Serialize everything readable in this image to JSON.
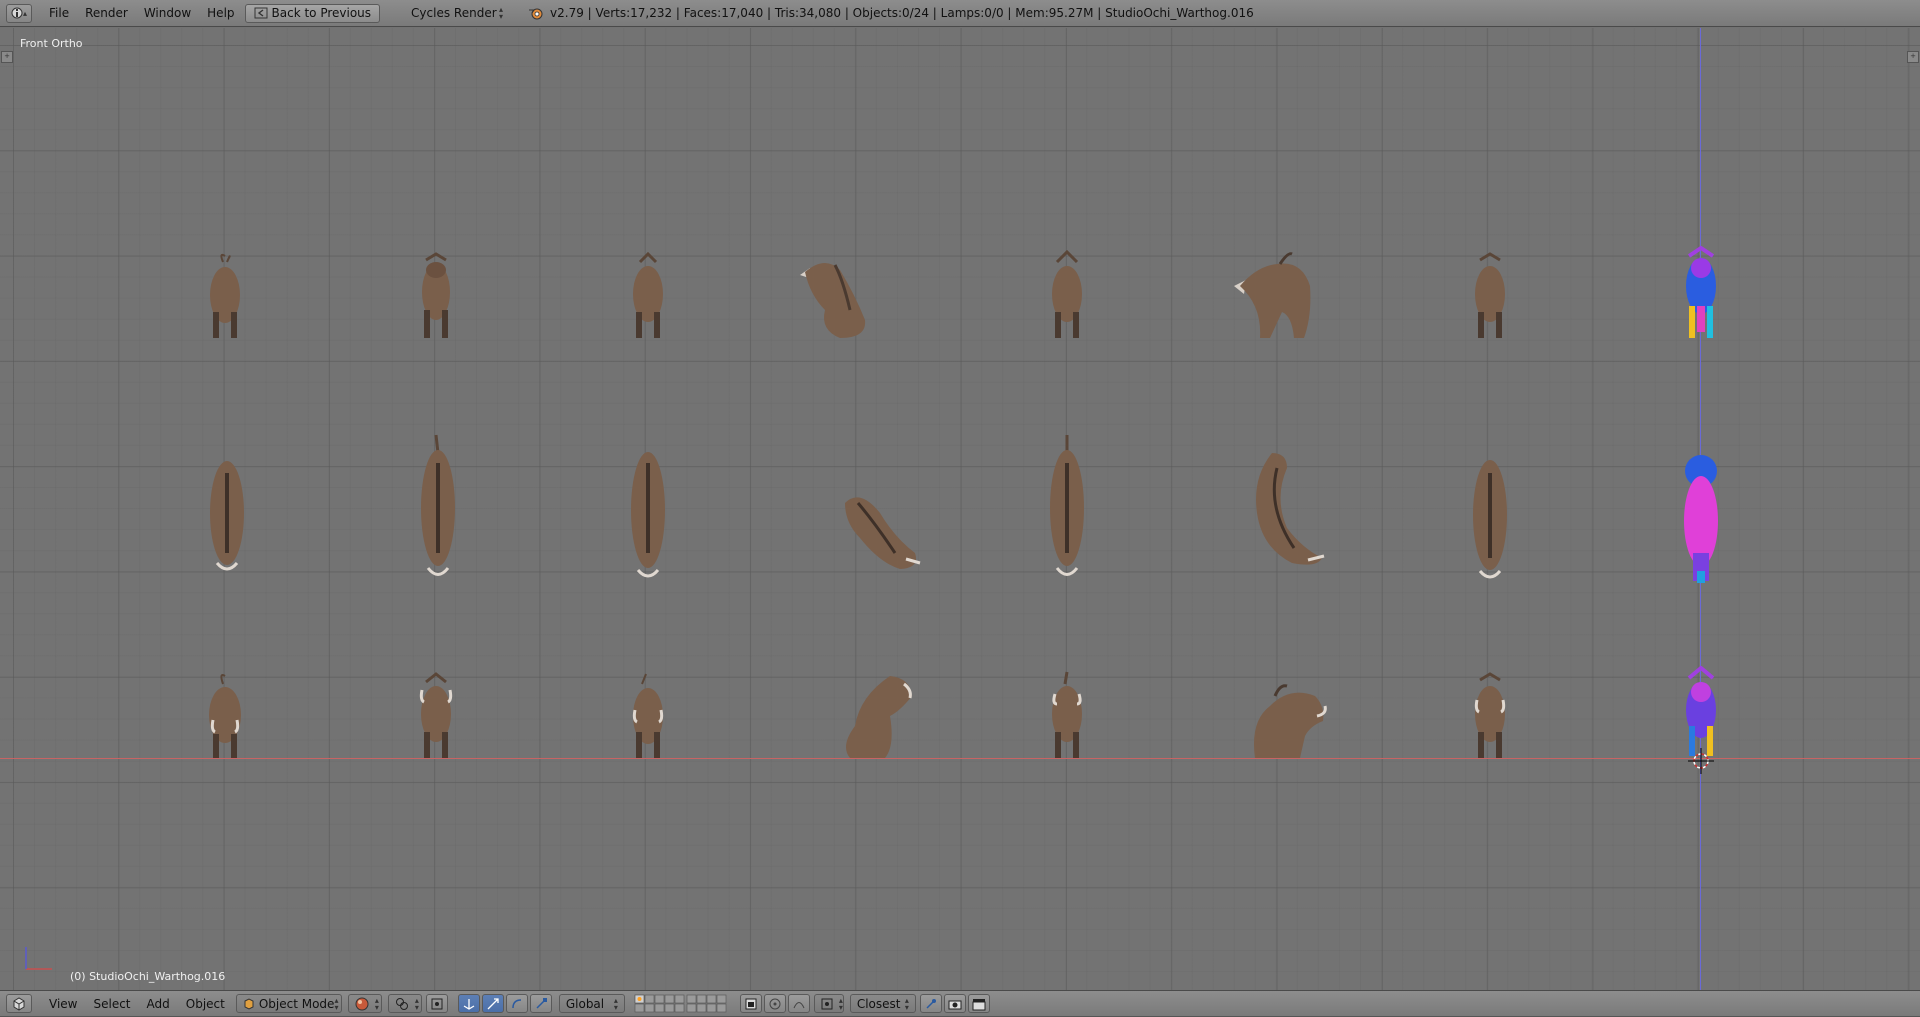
{
  "top_header": {
    "info_icon": "info-icon",
    "menus": [
      "File",
      "Render",
      "Window",
      "Help"
    ],
    "back_button": "Back to Previous",
    "render_engine": "Cycles Render",
    "stats": "v2.79 | Verts:17,232 | Faces:17,040 | Tris:34,080 | Objects:0/24 | Lamps:0/0 | Mem:95.27M | StudioOchi_Warthog.016"
  },
  "viewport": {
    "view_name": "Front Ortho",
    "active_object_label": "(0) StudioOchi_Warthog.016",
    "colors": {
      "background": "#737373",
      "x_axis": "#c86464",
      "z_axis": "#6a6ad8",
      "model_brown": "#7a5f4b",
      "model_dark": "#4a3a30"
    }
  },
  "bottom_header": {
    "editor_icon": "3d-view-icon",
    "menus": [
      "View",
      "Select",
      "Add",
      "Object"
    ],
    "mode": "Object Mode",
    "shading_icon": "sphere-shading-icon",
    "pivot_icon": "pivot-icon",
    "manipulator_icons": [
      "translate-icon",
      "rotate-icon",
      "scale-icon"
    ],
    "orientation": "Global",
    "snap_target": "Closest",
    "render_icons": [
      "camera-render-icon",
      "clapper-icon"
    ]
  }
}
